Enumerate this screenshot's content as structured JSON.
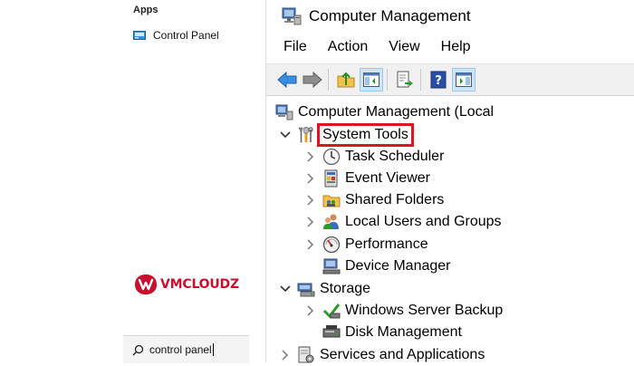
{
  "start_menu": {
    "apps_header": "Apps",
    "best_match_label": "Control Panel",
    "search_value": "control panel"
  },
  "branding": {
    "logo_text": "VMCLOUDZ",
    "brand_color": "#c8102e"
  },
  "window": {
    "title": "Computer Management",
    "menu": [
      "File",
      "Action",
      "View",
      "Help"
    ],
    "toolbar_icons": [
      "back-arrow-icon",
      "forward-arrow-icon",
      "up-folder-icon",
      "show-hide-console-tree-icon",
      "export-list-icon",
      "help-icon",
      "show-hide-action-pane-icon"
    ]
  },
  "tree": {
    "root": "Computer Management (Local",
    "system_tools": "System Tools",
    "task_scheduler": "Task Scheduler",
    "event_viewer": "Event Viewer",
    "shared_folders": "Shared Folders",
    "local_users_groups": "Local Users and Groups",
    "performance": "Performance",
    "device_manager": "Device Manager",
    "storage": "Storage",
    "windows_server_backup": "Windows Server Backup",
    "disk_management": "Disk Management",
    "services_apps": "Services and Applications"
  },
  "colors": {
    "highlight_border": "#e0141e",
    "toolbar_bg": "#f0f0f0",
    "pressed_bg": "#cce4f7"
  }
}
